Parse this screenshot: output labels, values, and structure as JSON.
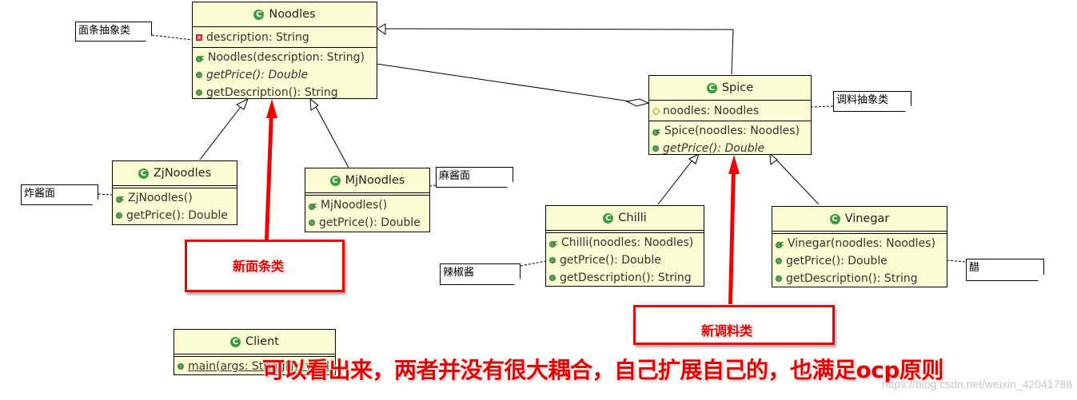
{
  "diagram": {
    "type": "UML class diagram",
    "classes": {
      "noodles": {
        "name": "Noodles",
        "attributes": [
          {
            "visibility": "private",
            "text": "description: String"
          }
        ],
        "operations": [
          {
            "kind": "constructor",
            "text": "Noodles(description: String)"
          },
          {
            "kind": "abstract",
            "text": "getPrice(): Double"
          },
          {
            "kind": "public",
            "text": "getDescription(): String"
          }
        ]
      },
      "spice": {
        "name": "Spice",
        "attributes": [
          {
            "visibility": "protected",
            "text": "noodles: Noodles"
          }
        ],
        "operations": [
          {
            "kind": "constructor",
            "text": "Spice(noodles: Noodles)"
          },
          {
            "kind": "abstract",
            "text": "getPrice(): Double"
          }
        ]
      },
      "zjnoodles": {
        "name": "ZjNoodles",
        "operations": [
          {
            "kind": "constructor",
            "text": "ZjNoodles()"
          },
          {
            "kind": "public",
            "text": "getPrice(): Double"
          }
        ]
      },
      "mjnoodles": {
        "name": "MjNoodles",
        "operations": [
          {
            "kind": "constructor",
            "text": "MjNoodles()"
          },
          {
            "kind": "public",
            "text": "getPrice(): Double"
          }
        ]
      },
      "chilli": {
        "name": "Chilli",
        "operations": [
          {
            "kind": "constructor",
            "text": "Chilli(noodles: Noodles)"
          },
          {
            "kind": "public",
            "text": "getPrice(): Double"
          },
          {
            "kind": "public",
            "text": "getDescription(): String"
          }
        ]
      },
      "vinegar": {
        "name": "Vinegar",
        "operations": [
          {
            "kind": "constructor",
            "text": "Vinegar(noodles: Noodles)"
          },
          {
            "kind": "public",
            "text": "getPrice(): Double"
          },
          {
            "kind": "public",
            "text": "getDescription(): String"
          }
        ]
      },
      "client": {
        "name": "Client",
        "operations": [
          {
            "kind": "static",
            "text": "main(args: String[]): void"
          }
        ]
      }
    },
    "notes": {
      "noodles": "面条抽象类",
      "spice": "调料抽象类",
      "zjnoodles": "炸酱面",
      "mjnoodles": "麻酱面",
      "chilli": "辣椒酱",
      "vinegar": "醋"
    },
    "relations": [
      {
        "type": "generalization",
        "from": "ZjNoodles",
        "to": "Noodles"
      },
      {
        "type": "generalization",
        "from": "MjNoodles",
        "to": "Noodles"
      },
      {
        "type": "generalization",
        "from": "Spice",
        "to": "Noodles"
      },
      {
        "type": "aggregation",
        "from": "Noodles",
        "to": "Spice"
      },
      {
        "type": "generalization",
        "from": "Chilli",
        "to": "Spice"
      },
      {
        "type": "generalization",
        "from": "Vinegar",
        "to": "Spice"
      }
    ]
  },
  "annotations": {
    "new_noodles": "新面条类",
    "new_spice": "新调料类",
    "conclusion": "可以看出来，两者并没有很大耦合，自己扩展自己的，也满足ocp原则"
  },
  "colors": {
    "class_fill": "#fcfcd2",
    "annotation_red": "#f00000",
    "icon_green": "#3c9a3c"
  },
  "watermark": "https://blog.csdn.net/weixin_42041788"
}
